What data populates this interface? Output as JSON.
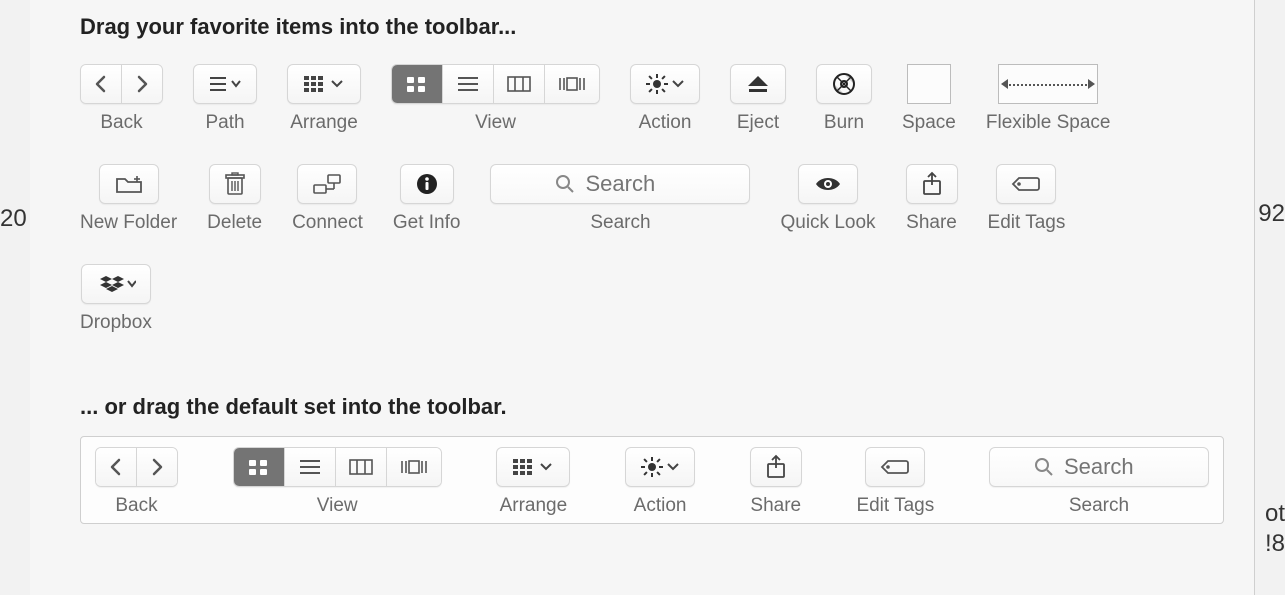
{
  "headings": {
    "drag_favorites": "Drag your favorite items into the toolbar...",
    "drag_default": "... or drag the default set into the toolbar."
  },
  "palette": {
    "back": "Back",
    "path": "Path",
    "arrange": "Arrange",
    "view": "View",
    "action": "Action",
    "eject": "Eject",
    "burn": "Burn",
    "space": "Space",
    "flexible_space": "Flexible Space",
    "new_folder": "New Folder",
    "delete": "Delete",
    "connect": "Connect",
    "get_info": "Get Info",
    "search": "Search",
    "quick_look": "Quick Look",
    "share": "Share",
    "edit_tags": "Edit Tags",
    "dropbox": "Dropbox"
  },
  "defaults": {
    "back": "Back",
    "view": "View",
    "arrange": "Arrange",
    "action": "Action",
    "share": "Share",
    "edit_tags": "Edit Tags",
    "search": "Search"
  },
  "search_placeholder": "Search",
  "bg": {
    "left": "20",
    "right1": "92",
    "right2": "ot",
    "right3": "!8"
  }
}
